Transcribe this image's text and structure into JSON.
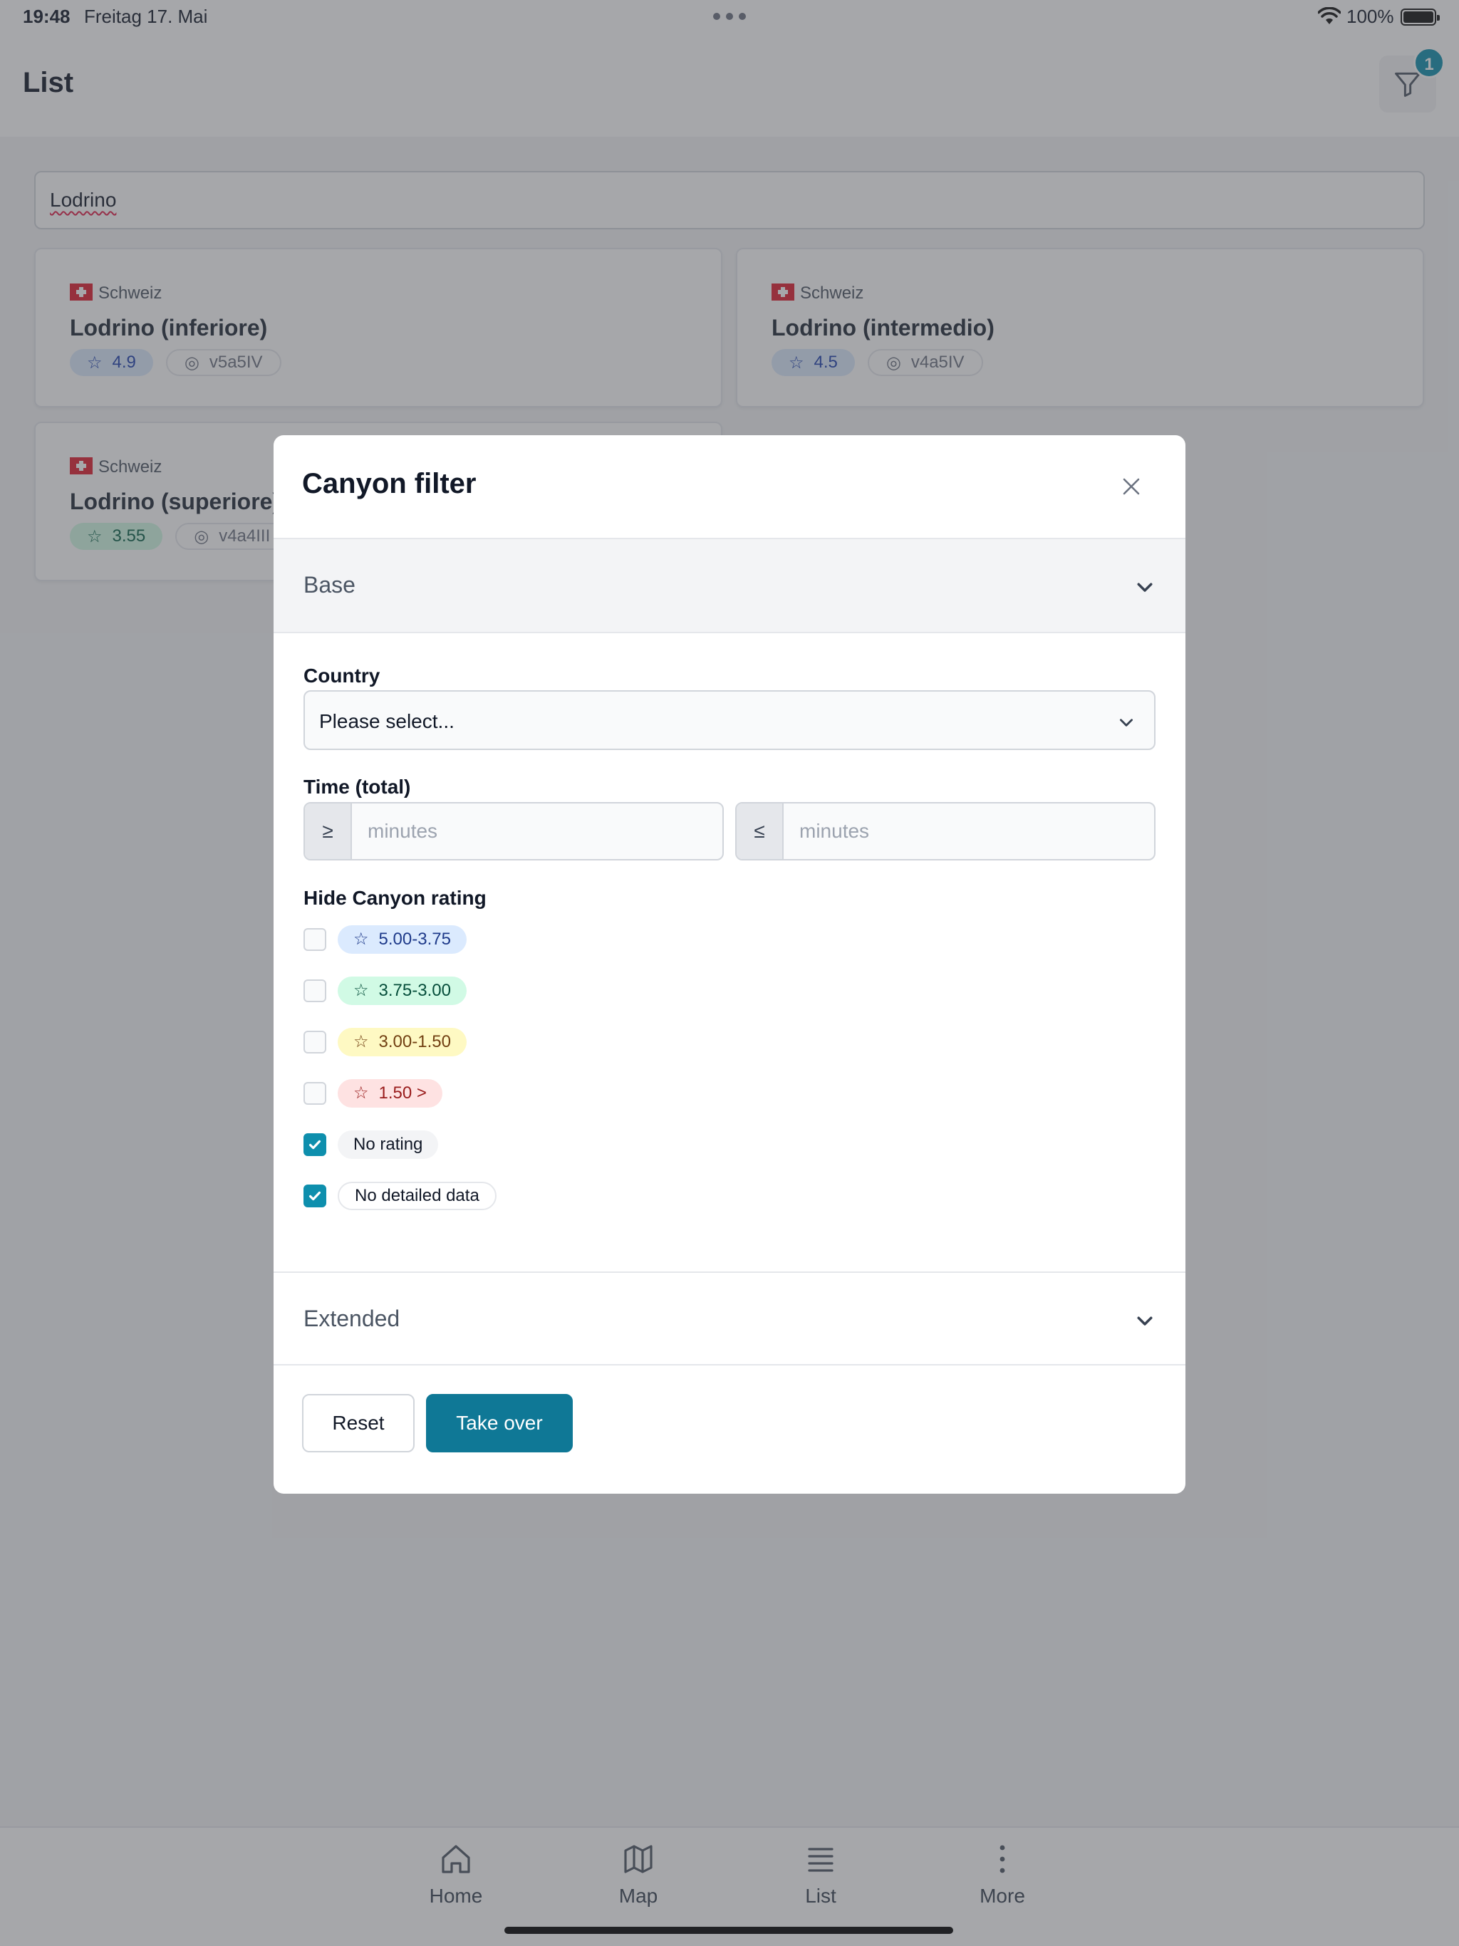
{
  "status_bar": {
    "time": "19:48",
    "date": "Freitag 17. Mai",
    "battery": "100%"
  },
  "header": {
    "title": "List",
    "filter_count": "1"
  },
  "search": {
    "value": "Lodrino"
  },
  "cards": [
    {
      "country": "Schweiz",
      "name": "Lodrino (inferiore)",
      "rating": "4.9",
      "code": "v5a5IV"
    },
    {
      "country": "Schweiz",
      "name": "Lodrino (intermedio)",
      "rating": "4.5",
      "code": "v4a5IV"
    },
    {
      "country": "Schweiz",
      "name": "Lodrino (superiore)",
      "rating": "3.55",
      "code": "v4a4III"
    }
  ],
  "modal": {
    "title": "Canyon filter",
    "base_label": "Base",
    "country_label": "Country",
    "country_value": "Please select...",
    "time_label": "Time (total)",
    "min_prefix": "≥",
    "max_prefix": "≤",
    "minutes_placeholder": "minutes",
    "hide_rating_label": "Hide Canyon rating",
    "rating_options": [
      {
        "label": "5.00-3.75",
        "checked": false
      },
      {
        "label": "3.75-3.00",
        "checked": false
      },
      {
        "label": "3.00-1.50",
        "checked": false
      },
      {
        "label": "1.50 >",
        "checked": false
      },
      {
        "label": "No rating",
        "checked": true
      },
      {
        "label": "No detailed data",
        "checked": true
      }
    ],
    "extended_label": "Extended",
    "reset_label": "Reset",
    "take_over_label": "Take over"
  },
  "nav": {
    "home": "Home",
    "map": "Map",
    "list": "List",
    "more": "More"
  },
  "colors": {
    "accent": "#0e8fad",
    "primary_button": "#0f7896",
    "swiss_red": "#e11d2e"
  }
}
